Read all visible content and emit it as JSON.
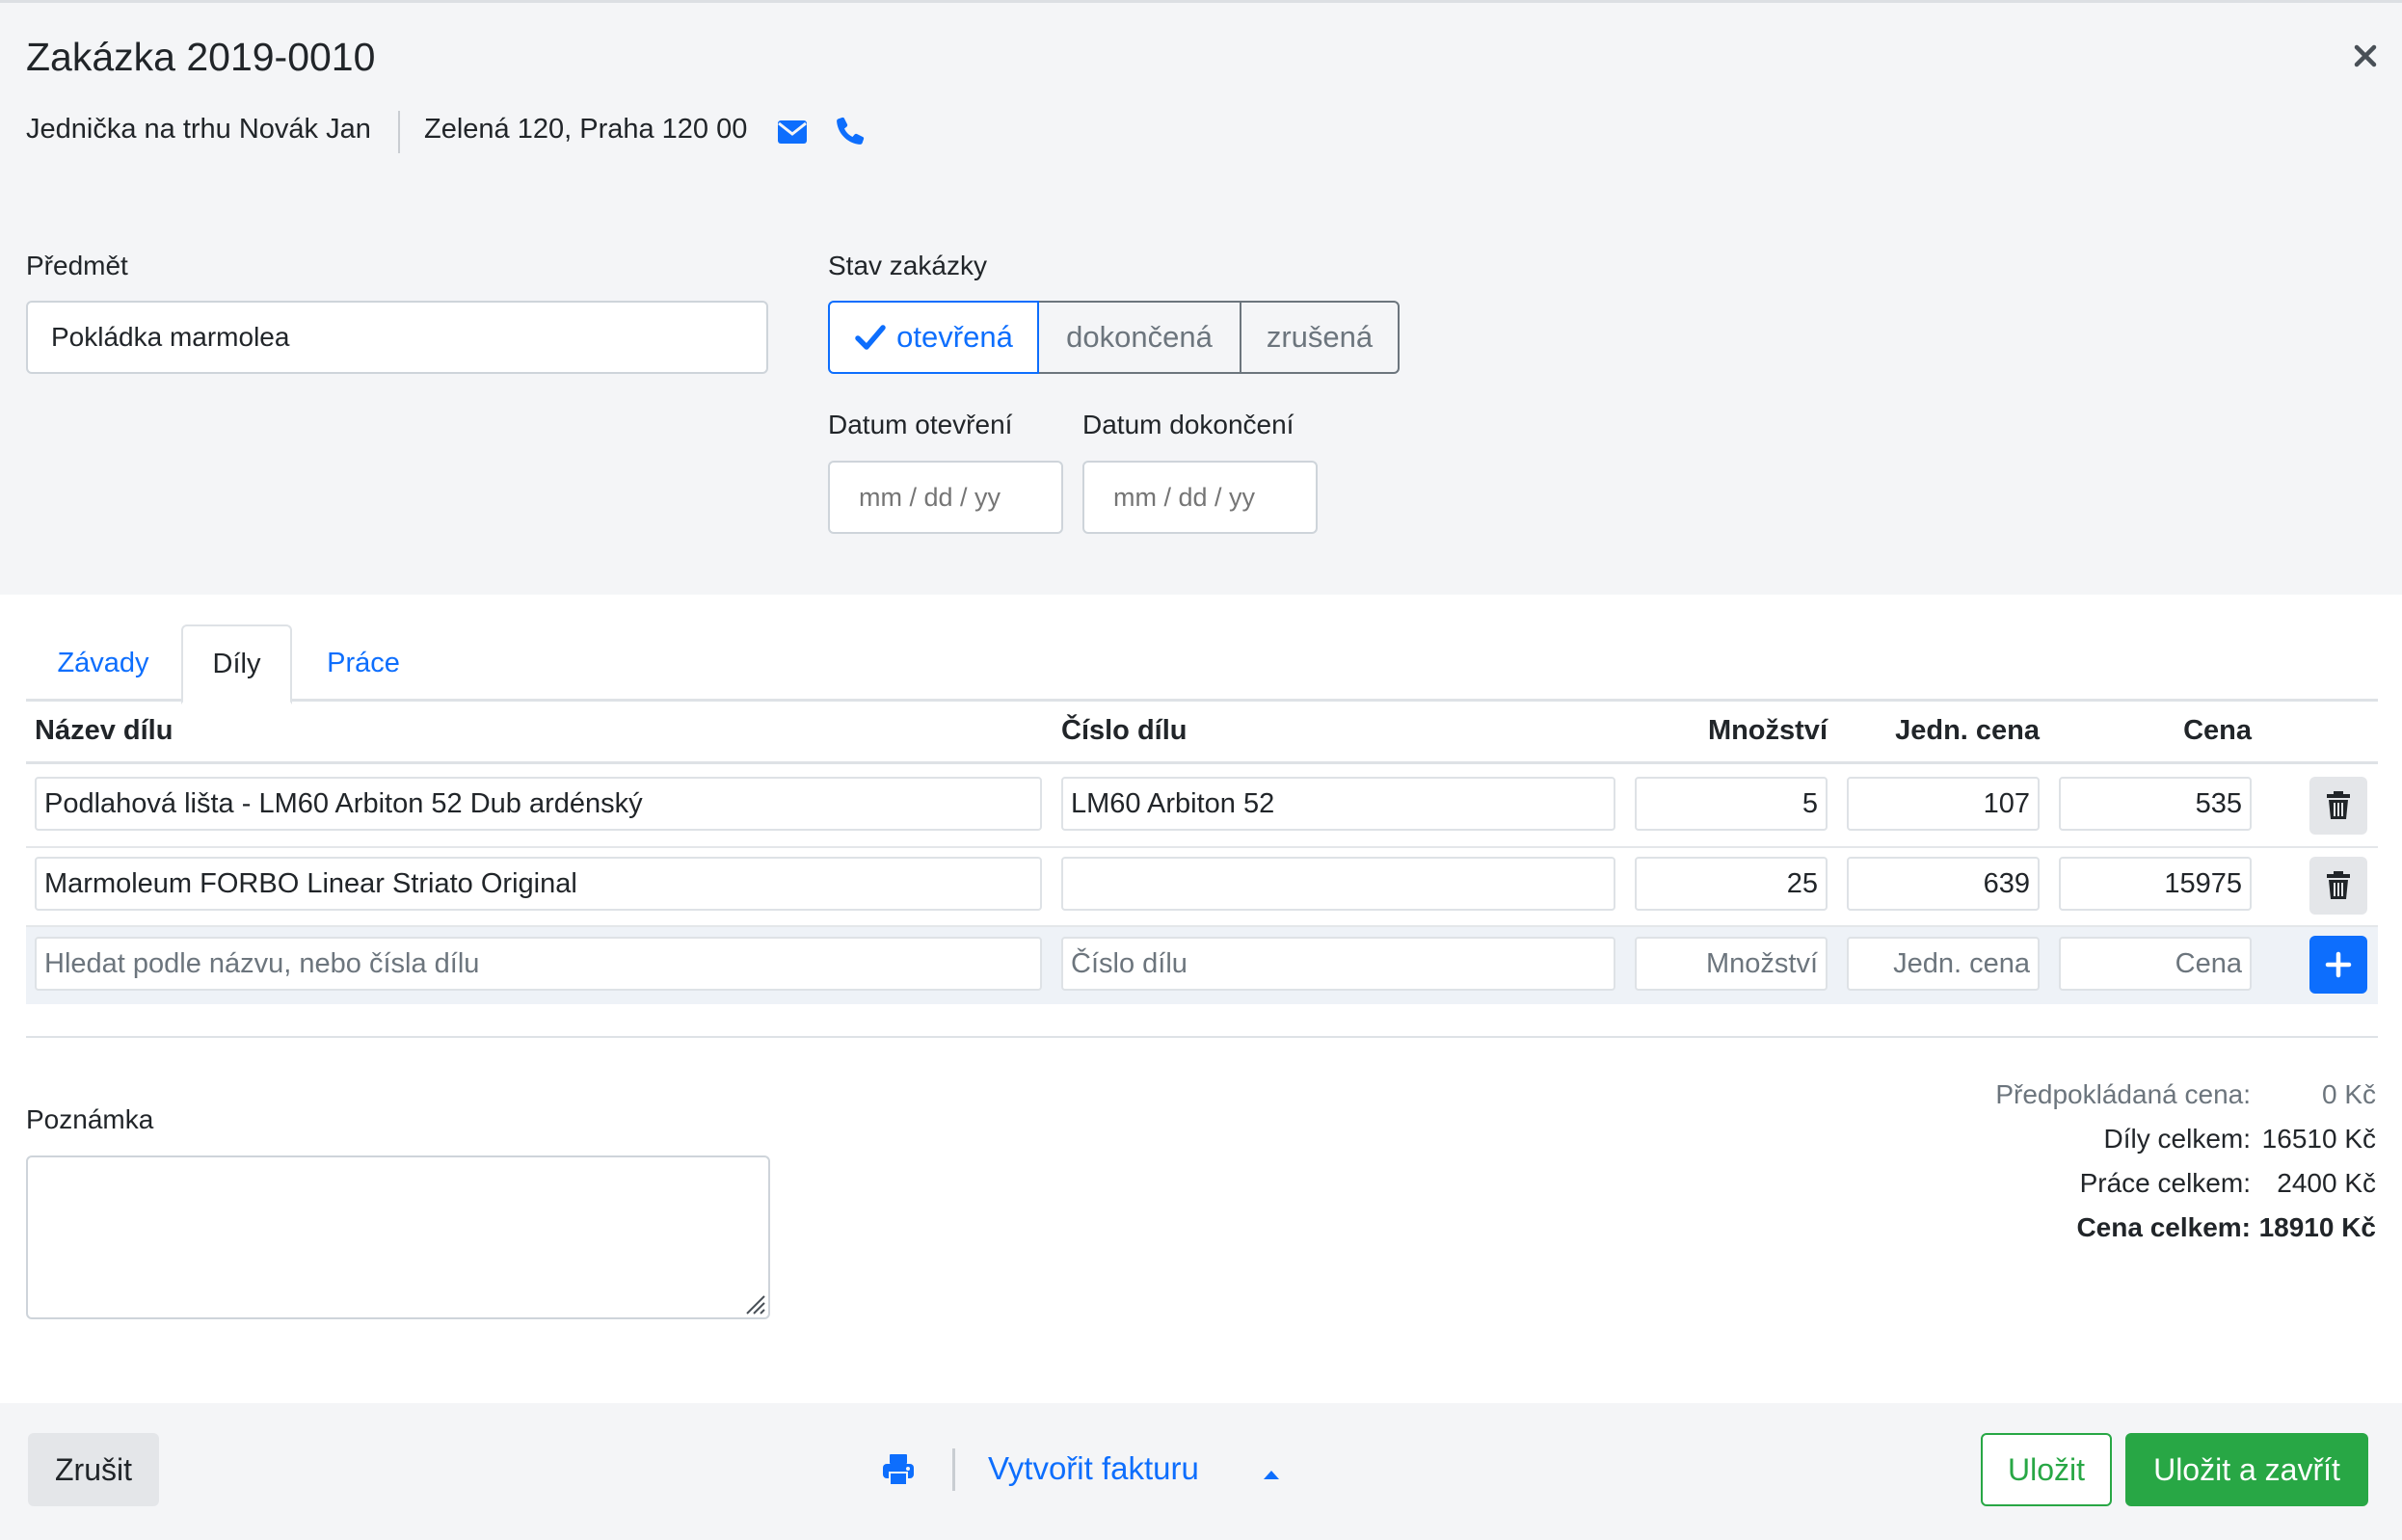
{
  "header": {
    "title": "Zakázka 2019-0010",
    "customer": "Jednička na trhu Novák Jan",
    "address": "Zelená 120, Praha 120 00",
    "icons": [
      "close-icon",
      "envelope-icon",
      "phone-icon"
    ]
  },
  "form": {
    "subject_label": "Předmět",
    "subject_value": "Pokládka marmolea",
    "status_label": "Stav zakázky",
    "status_options": [
      "otevřená",
      "dokončená",
      "zrušená"
    ],
    "status_selected": "otevřená",
    "open_date_label": "Datum otevření",
    "open_date_placeholder": "mm / dd / yy",
    "close_date_label": "Datum dokončení",
    "close_date_placeholder": "mm / dd / yy"
  },
  "tabs": [
    {
      "label": "Závady",
      "active": false
    },
    {
      "label": "Díly",
      "active": true
    },
    {
      "label": "Práce",
      "active": false
    }
  ],
  "parts_table": {
    "columns": [
      "Název dílu",
      "Číslo dílu",
      "Množství",
      "Jedn. cena",
      "Cena"
    ],
    "rows": [
      {
        "name": "Podlahová lišta - LM60 Arbiton 52 Dub ardénský",
        "number": "LM60 Arbiton 52",
        "qty": "5",
        "unit_price": "107",
        "price": "535"
      },
      {
        "name": "Marmoleum FORBO Linear Striato Original",
        "number": "",
        "qty": "25",
        "unit_price": "639",
        "price": "15975"
      }
    ],
    "new_row_placeholders": {
      "name": "Hledat podle názvu, nebo čísla dílu",
      "number": "Číslo dílu",
      "qty": "Množství",
      "unit_price": "Jedn. cena",
      "price": "Cena"
    }
  },
  "note": {
    "label": "Poznámka",
    "value": ""
  },
  "totals": {
    "estimated_label": "Předpokládaná cena:",
    "estimated_value": "0 Kč",
    "parts_label": "Díly celkem:",
    "parts_value": "16510 Kč",
    "work_label": "Práce celkem:",
    "work_value": "2400 Kč",
    "total_label": "Cena celkem:",
    "total_value": "18910 Kč"
  },
  "footer": {
    "cancel_label": "Zrušit",
    "invoice_label": "Vytvořit fakturu",
    "save_label": "Uložit",
    "save_close_label": "Uložit a zavřít"
  },
  "colors": {
    "primary": "#0d6efd",
    "success": "#28a745",
    "panel": "#f4f5f7"
  }
}
